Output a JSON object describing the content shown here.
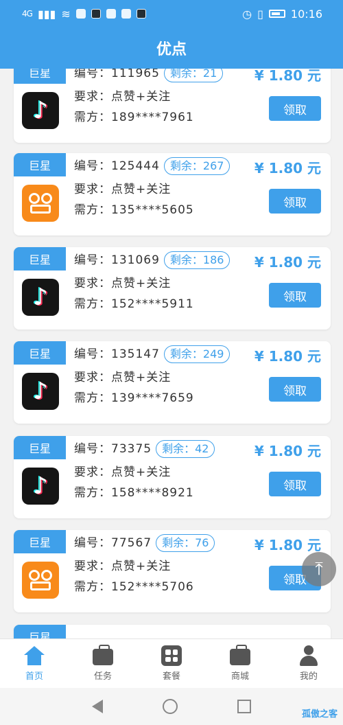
{
  "status_bar": {
    "signal": "4G",
    "time": "10:16"
  },
  "header": {
    "title": "优点"
  },
  "cards": [
    {
      "tag": "巨星",
      "app": "tiktok",
      "id_label": "编号：",
      "id": "111965",
      "remain": "剩余：21",
      "req": "要求：点赞+关注",
      "buyer": "需方：189****7961",
      "price": "¥ 1.80 元",
      "button": "领取"
    },
    {
      "tag": "巨星",
      "app": "kuaishou",
      "id_label": "编号：",
      "id": "125444",
      "remain": "剩余：267",
      "req": "要求：点赞+关注",
      "buyer": "需方：135****5605",
      "price": "¥ 1.80 元",
      "button": "领取"
    },
    {
      "tag": "巨星",
      "app": "tiktok",
      "id_label": "编号：",
      "id": "131069",
      "remain": "剩余：186",
      "req": "要求：点赞+关注",
      "buyer": "需方：152****5911",
      "price": "¥ 1.80 元",
      "button": "领取"
    },
    {
      "tag": "巨星",
      "app": "tiktok",
      "id_label": "编号：",
      "id": "135147",
      "remain": "剩余：249",
      "req": "要求：点赞+关注",
      "buyer": "需方：139****7659",
      "price": "¥ 1.80 元",
      "button": "领取"
    },
    {
      "tag": "巨星",
      "app": "tiktok",
      "id_label": "编号：",
      "id": "73375",
      "remain": "剩余：42",
      "req": "要求：点赞+关注",
      "buyer": "需方：158****8921",
      "price": "¥ 1.80 元",
      "button": "领取"
    },
    {
      "tag": "巨星",
      "app": "kuaishou",
      "id_label": "编号：",
      "id": "77567",
      "remain": "剩余：76",
      "req": "要求：点赞+关注",
      "buyer": "需方：152****5706",
      "price": "¥ 1.80 元",
      "button": "领取"
    },
    {
      "tag": "巨星"
    }
  ],
  "tabs": [
    {
      "label": "首页",
      "icon": "home-icon"
    },
    {
      "label": "任务",
      "icon": "briefcase-icon"
    },
    {
      "label": "套餐",
      "icon": "grid-icon"
    },
    {
      "label": "商城",
      "icon": "shop-bag-icon"
    },
    {
      "label": "我的",
      "icon": "person-icon"
    }
  ],
  "watermark": "孤傲之客",
  "colors": {
    "primary": "#3fa0ea",
    "background": "#f2f2f2"
  }
}
